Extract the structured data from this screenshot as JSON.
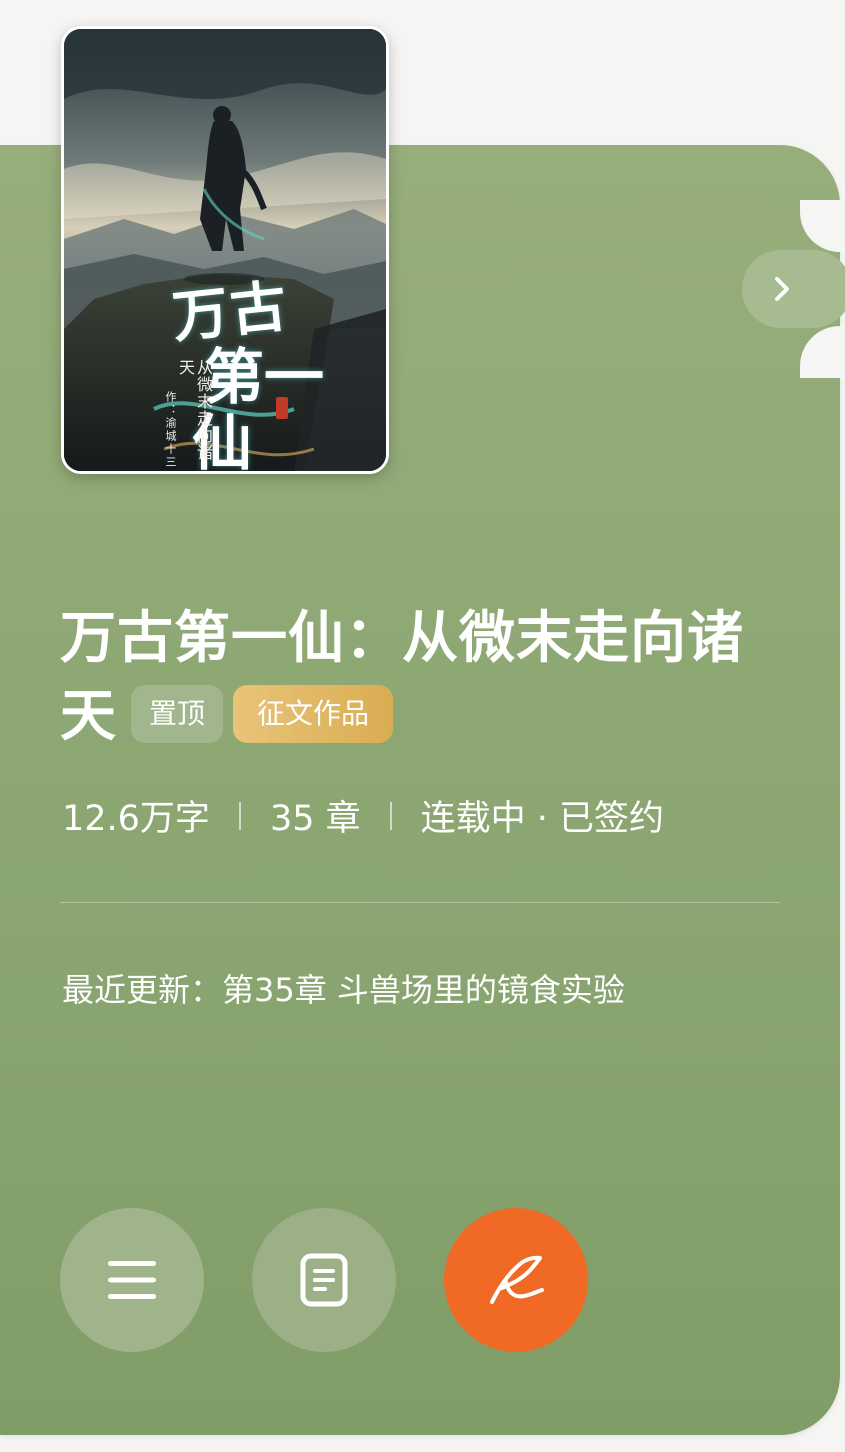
{
  "cover": {
    "title_line1": "万古",
    "title_line2": "第一",
    "title_line3": "仙",
    "subtitle": "从微末走向诸天",
    "author": "作：渝城十三"
  },
  "book": {
    "title": "万古第一仙：从微末走向诸天",
    "badges": {
      "pin": "置顶",
      "contest": "征文作品"
    },
    "meta": {
      "words": "12.6万字",
      "chapters": "35 章",
      "status": "连载中 · 已签约"
    },
    "latest_update": "最近更新：第35章 斗兽场里的镜食实验"
  },
  "actions": {
    "menu_icon": "menu-icon",
    "doc_icon": "document-icon",
    "write_icon": "quill-icon",
    "arrow_icon": "chevron-right-icon"
  },
  "colors": {
    "card_green": "#8ba672",
    "accent_orange": "#f06a25",
    "contest_gold": "#ddb25a",
    "background": "#f5f5f4"
  }
}
